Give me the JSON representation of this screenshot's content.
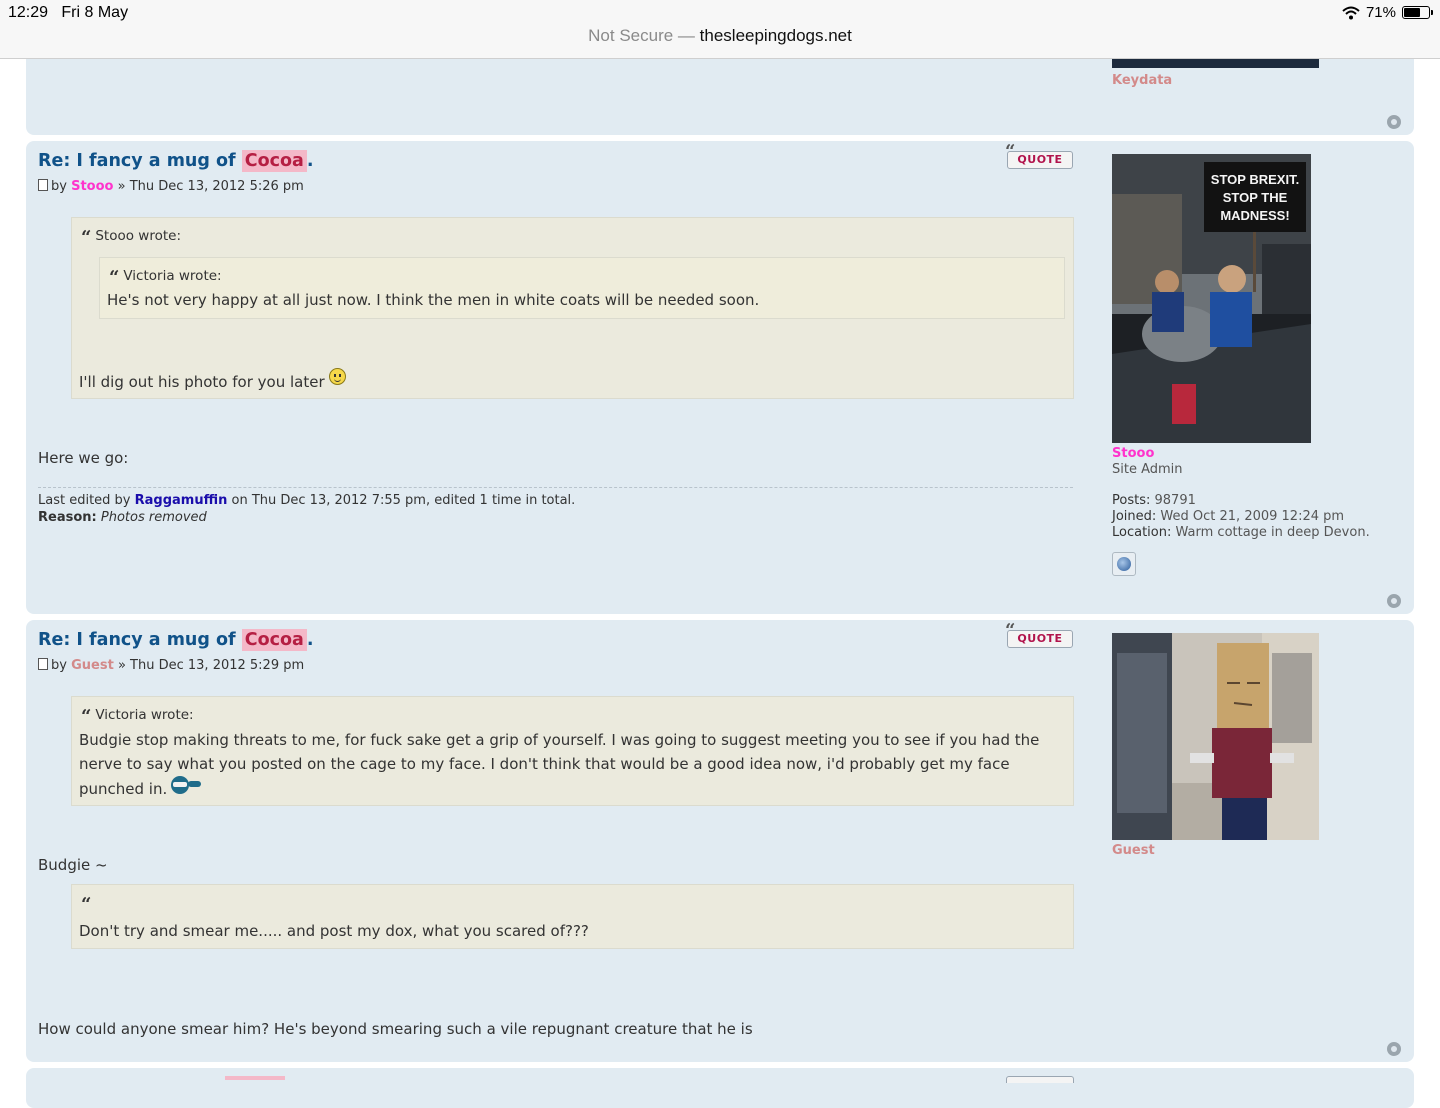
{
  "status_bar": {
    "time": "12:29",
    "date": "Fri 8 May",
    "battery": "71%",
    "battery_level": 0.71,
    "url_insecure": "Not Secure —",
    "url_domain": "thesleepingdogs.net"
  },
  "prev_post": {
    "poster_name": "Keydata"
  },
  "posts": [
    {
      "title_prefix": "Re: I fancy a mug of ",
      "title_highlight": "Cocoa",
      "title_suffix": ".",
      "by": "by",
      "author": "Stooo",
      "sep": "»",
      "date": "Thu Dec 13, 2012 5:26 pm",
      "quote_button": "QUOTE",
      "outer_quote": {
        "cite": "Stooo wrote:",
        "inner_quote": {
          "cite": "Victoria wrote:",
          "text": "He's not very happy at all just now. I think the men in white coats will be needed soon."
        },
        "text": "I'll dig out his photo for you later"
      },
      "body": "Here we go:",
      "edit": {
        "prefix": "Last edited by",
        "editor": "Raggamuffin",
        "suffix": "on Thu Dec 13, 2012 7:55 pm, edited 1 time in total.",
        "reason_label": "Reason:",
        "reason": "Photos removed"
      },
      "profile": {
        "name": "Stooo",
        "rank": "Site Admin",
        "posts_label": "Posts:",
        "posts": "98791",
        "joined_label": "Joined:",
        "joined": "Wed Oct 21, 2009 12:24 pm",
        "location_label": "Location:",
        "location": "Warm cottage in deep Devon.",
        "avatar_sign": [
          "STOP BREXIT.",
          "STOP THE",
          "MADNESS!"
        ]
      }
    },
    {
      "title_prefix": "Re: I fancy a mug of ",
      "title_highlight": "Cocoa",
      "title_suffix": ".",
      "by": "by",
      "author": "Guest",
      "sep": "»",
      "date": "Thu Dec 13, 2012 5:29 pm",
      "quote_button": "QUOTE",
      "quote1": {
        "cite": "Victoria wrote:",
        "line1": "Budgie stop making threats to me, for fuck sake get a grip of yourself. I was going to suggest meeting you to see if you had the",
        "line2": "nerve to say what you posted on the cage to my face. I don't think that would be a good idea now, i'd probably get my face",
        "line3": "punched in."
      },
      "body1": "Budgie ~",
      "quote2": {
        "text": "Don't try and smear me..... and post my dox, what you scared of???"
      },
      "body2": "How could anyone smear him? He's beyond smearing such a vile repugnant creature that he is",
      "profile": {
        "name": "Guest"
      }
    }
  ],
  "colors": {
    "post_bg": "#e1ebf2",
    "title": "#105289",
    "admin_name": "#ff33cc",
    "guest_name": "#d38a8a",
    "quote_bg": "#ebeadd",
    "highlight": "#f4b8c8"
  }
}
